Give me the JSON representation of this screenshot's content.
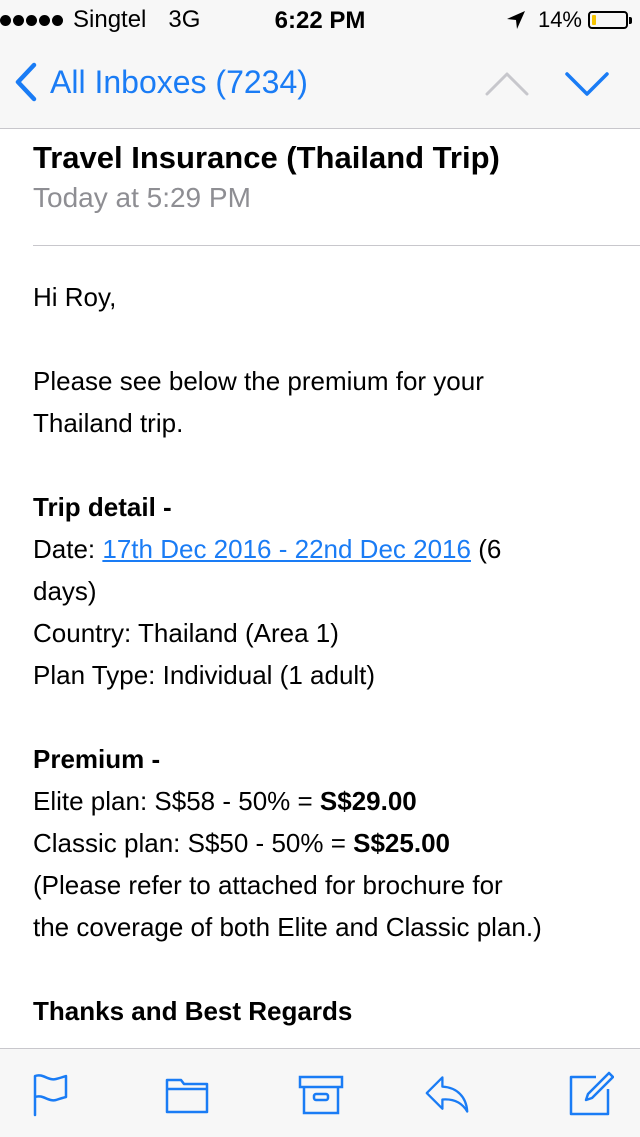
{
  "status_bar": {
    "carrier": "Singtel",
    "network": "3G",
    "time": "6:22 PM",
    "battery_text": "14%",
    "battery_level": 0.14,
    "battery_color": "#f5c400"
  },
  "nav": {
    "back_label": "All Inboxes (7234)",
    "accent_color": "#1a7cf5"
  },
  "message": {
    "subject": "Travel Insurance (Thailand Trip)",
    "date": "Today at 5:29 PM",
    "greeting": "Hi Roy,",
    "intro_1": "Please see below the premium for your",
    "intro_2": "Thailand trip.",
    "trip_heading": "Trip detail -",
    "date_prefix": "Date: ",
    "date_link": "17th Dec 2016 - 22nd Dec 2016",
    "date_suffix_1": " (6",
    "date_suffix_2": "days)",
    "country": "Country: Thailand (Area 1)",
    "plan_type": "Plan Type: Individual (1 adult)",
    "premium_heading": "Premium -",
    "elite_prefix": "Elite plan: S$58 - 50% = ",
    "elite_price": "S$29.00",
    "classic_prefix": "Classic plan: S$50 - 50% = ",
    "classic_price": "S$25.00",
    "note_1": "(Please refer to attached for brochure for",
    "note_2": "the coverage of both Elite and Classic plan.)",
    "signoff": "Thanks and Best Regards"
  },
  "toolbar": {
    "icons": [
      "flag-icon",
      "folder-icon",
      "archive-icon",
      "reply-icon",
      "compose-icon"
    ]
  }
}
